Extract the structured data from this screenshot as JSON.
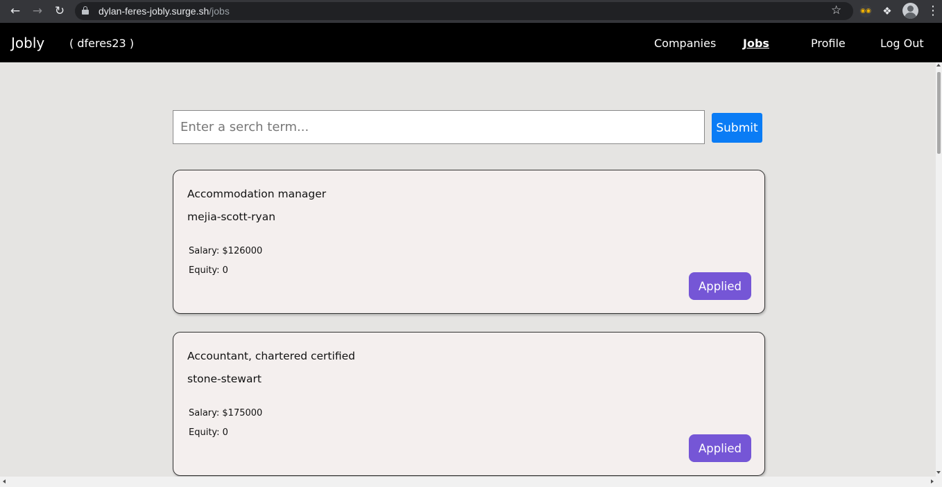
{
  "browser": {
    "url_host": "dylan-feres-jobly.surge.sh",
    "url_path": "/jobs",
    "icons": {
      "back": "arrow-left",
      "forward": "arrow-right",
      "reload": "reload",
      "star": "star",
      "extensions": "puzzle-piece",
      "menu": "three-dots-vertical"
    }
  },
  "navbar": {
    "brand": "Jobly",
    "username": "( dferes23 )",
    "links": [
      {
        "label": "Companies",
        "active": false
      },
      {
        "label": "Jobs",
        "active": true
      },
      {
        "label": "Profile",
        "active": false
      },
      {
        "label": "Log Out",
        "active": false
      }
    ]
  },
  "search": {
    "placeholder": "Enter a serch term...",
    "value": "",
    "submit_label": "Submit"
  },
  "jobs": [
    {
      "title": "Accommodation manager",
      "company": "mejia-scott-ryan",
      "salary": "Salary: $126000",
      "equity": "Equity: 0",
      "button_label": "Applied"
    },
    {
      "title": "Accountant, chartered certified",
      "company": "stone-stewart",
      "salary": "Salary: $175000",
      "equity": "Equity: 0",
      "button_label": "Applied"
    }
  ],
  "colors": {
    "page_background": "#e5e4e2",
    "navbar_background": "#000000",
    "card_background": "#f4efee",
    "submit_button": "#0a7cf5",
    "applied_button": "#7556d6"
  }
}
